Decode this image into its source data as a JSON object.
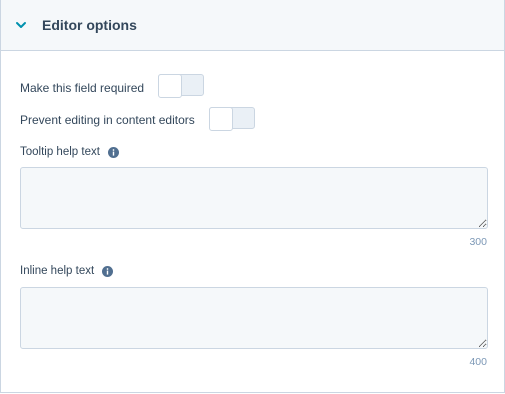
{
  "section": {
    "title": "Editor options",
    "expanded": true
  },
  "toggles": {
    "required_label": "Make this field required",
    "required_on": false,
    "prevent_edit_label": "Prevent editing in content editors",
    "prevent_edit_on": false
  },
  "tooltip": {
    "label": "Tooltip help text",
    "value": "",
    "max_chars": "300"
  },
  "inline_help": {
    "label": "Inline help text",
    "value": "",
    "max_chars": "400"
  },
  "icons": {
    "section_toggle": "chevron-down-icon",
    "info": "info-icon"
  },
  "colors": {
    "accent": "#0091ae",
    "text": "#33475b",
    "border": "#cbd6e2",
    "muted": "#7c98b6"
  }
}
